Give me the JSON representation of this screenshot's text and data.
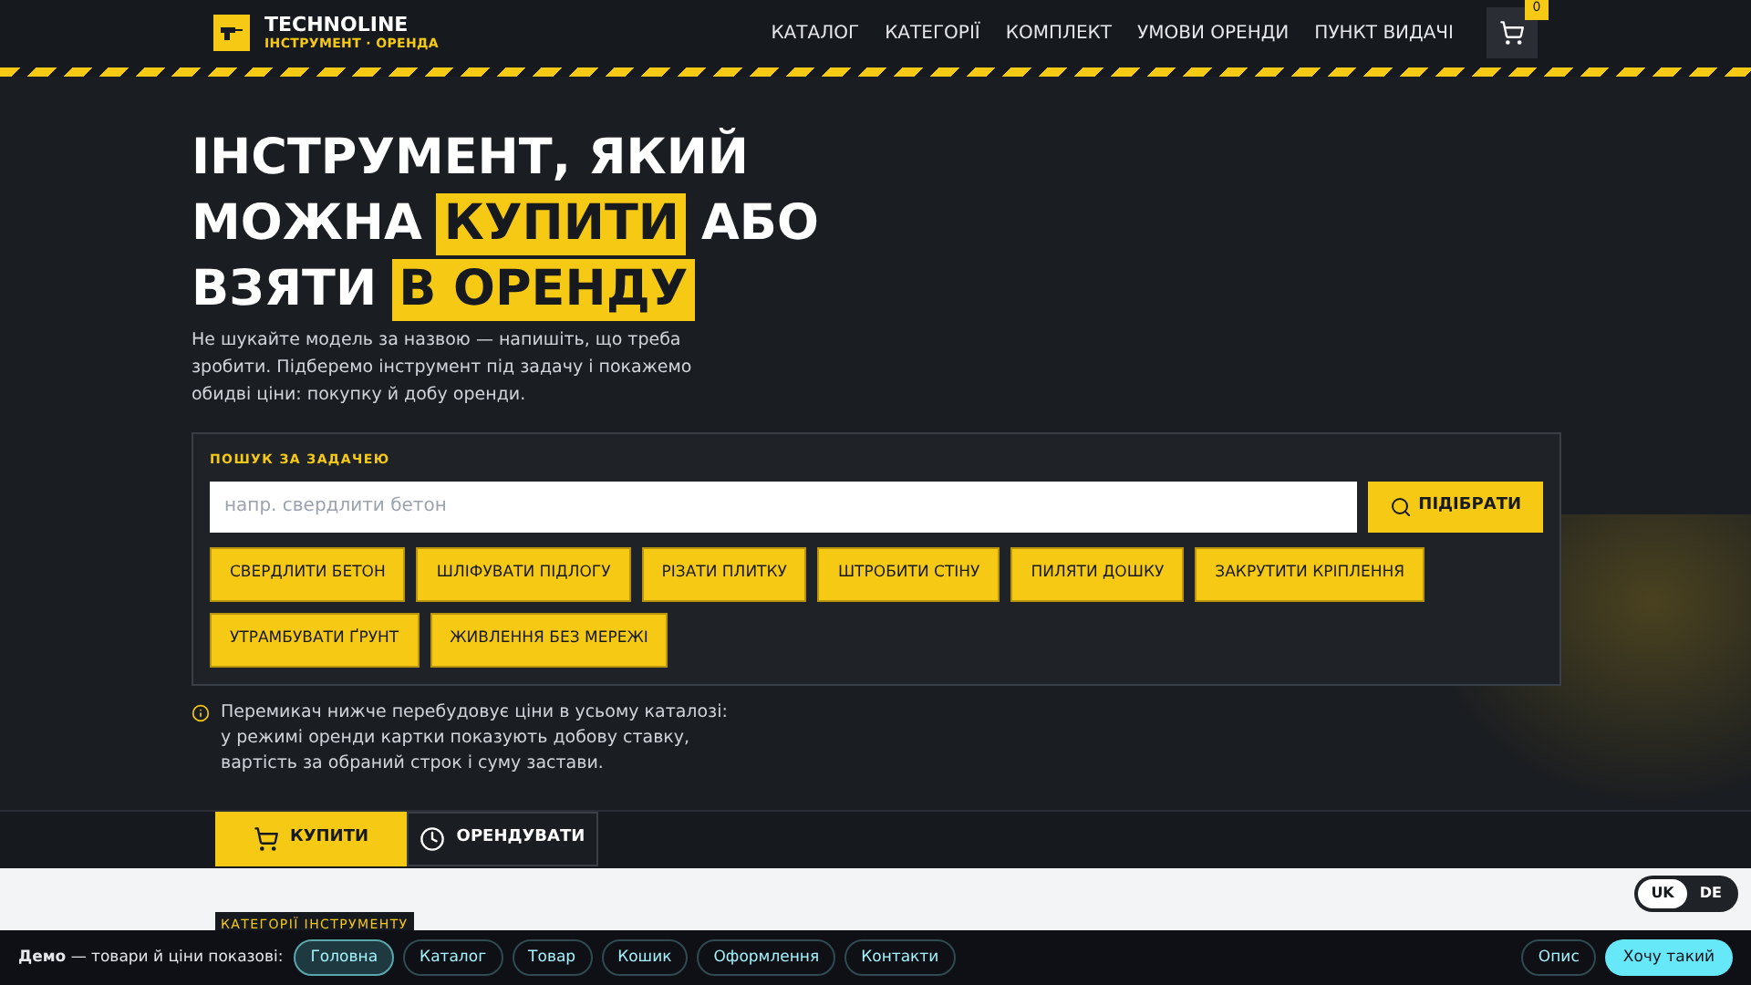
{
  "brand": {
    "name": "TECHNOLINE",
    "tagline": "ІНСТРУМЕНТ · ОРЕНДА"
  },
  "nav": [
    "КАТАЛОГ",
    "КАТЕГОРІЇ",
    "КОМПЛЕКТ",
    "УМОВИ ОРЕНДИ",
    "ПУНКТ ВИДАЧІ"
  ],
  "cart": {
    "count": "0"
  },
  "hero": {
    "title_lines": [
      [
        {
          "text": "ІНСТРУМЕНТ, ЯКИЙ",
          "highlight": false
        }
      ],
      [
        {
          "text": "МОЖНА",
          "highlight": false
        },
        {
          "text": "КУПИТИ",
          "highlight": true
        },
        {
          "text": "АБО",
          "highlight": false
        }
      ],
      [
        {
          "text": "ВЗЯТИ",
          "highlight": false
        },
        {
          "text": "В ОРЕНДУ",
          "highlight": true
        }
      ]
    ],
    "lead": "Не шукайте модель за назвою — напишіть, що треба зробити. Підберемо інструмент під задачу і покажемо обидві ціни: покупку й добу оренди."
  },
  "search": {
    "label": "ПОШУК ЗА ЗАДАЧЕЮ",
    "placeholder": "напр. свердлити бетон",
    "button": "ПІДІБРАТИ",
    "chips": [
      "СВЕРДЛИТИ БЕТОН",
      "ШЛІФУВАТИ ПІДЛОГУ",
      "РІЗАТИ ПЛИТКУ",
      "ШТРОБИТИ СТІНУ",
      "ПИЛЯТИ ДОШКУ",
      "ЗАКРУТИТИ КРІПЛЕННЯ",
      "УТРАМБУВАТИ ҐРУНТ",
      "ЖИВЛЕННЯ БЕЗ МЕРЕЖІ"
    ]
  },
  "note": "Перемикач нижче перебудовує ціни в усьому каталозі: у режимі оренди картки показують добову ставку, вартість за обраний строк і суму застави.",
  "mode_tabs": [
    {
      "label": "КУПИТИ",
      "selected": true
    },
    {
      "label": "ОРЕНДУВАТИ",
      "selected": false
    }
  ],
  "section_label": "КАТЕГОРІЇ ІНСТРУМЕНТУ",
  "languages": [
    {
      "label": "UK",
      "selected": true
    },
    {
      "label": "DE",
      "selected": false
    }
  ],
  "demo_bar": {
    "text": "**Демо** — товари й ціни показові:",
    "pages": [
      {
        "label": "Головна",
        "selected": true
      },
      {
        "label": "Каталог",
        "selected": false
      },
      {
        "label": "Товар",
        "selected": false
      },
      {
        "label": "Кошик",
        "selected": false
      },
      {
        "label": "Оформлення",
        "selected": false
      },
      {
        "label": "Контакти",
        "selected": false
      }
    ],
    "about": "Опис",
    "cta": "Хочу такий"
  }
}
